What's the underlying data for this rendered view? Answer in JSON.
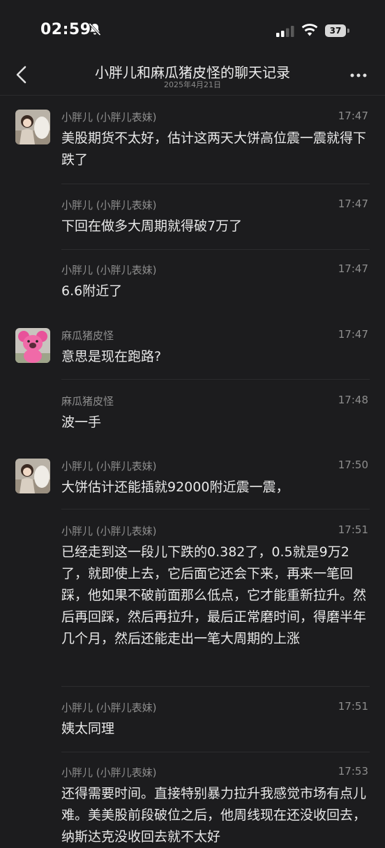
{
  "status": {
    "time": "02:59",
    "battery": "37"
  },
  "header": {
    "title": "小胖儿和麻瓜猪皮怪的聊天记录",
    "date": "2025年4月21日"
  },
  "messages": [
    {
      "sender": "小胖儿 (小胖儿表妹)",
      "time": "17:47",
      "text": "美股期货不太好，估计这两天大饼高位震一震就得下跌了"
    },
    {
      "sender": "小胖儿 (小胖儿表妹)",
      "time": "17:47",
      "text": "下回在做多大周期就得破7万了"
    },
    {
      "sender": "小胖儿 (小胖儿表妹)",
      "time": "17:47",
      "text": "6.6附近了"
    },
    {
      "sender": "麻瓜猪皮怪",
      "time": "17:47",
      "text": "意思是现在跑路?"
    },
    {
      "sender": "麻瓜猪皮怪",
      "time": "17:48",
      "text": "波一手"
    },
    {
      "sender": "小胖儿 (小胖儿表妹)",
      "time": "17:50",
      "text": "大饼估计还能插就92000附近震一震，"
    },
    {
      "sender": "小胖儿 (小胖儿表妹)",
      "time": "17:51",
      "text": "已经走到这一段儿下跌的0.382了，0.5就是9万2了，就即使上去，它后面它还会下来，再来一笔回踩，他如果不破前面那么低点，它才能重新拉升。然后再回踩，然后再拉升，最后正常磨时间，得磨半年几个月，然后还能走出一笔大周期的上涨"
    },
    {
      "sender": "小胖儿 (小胖儿表妹)",
      "time": "17:51",
      "text": "姨太同理"
    },
    {
      "sender": "小胖儿 (小胖儿表妹)",
      "time": "17:53",
      "text": "还得需要时间。直接特别暴力拉升我感觉市场有点儿难。美美股前段破位之后，他周线现在还没收回去，纳斯达克没收回去就不太好"
    }
  ]
}
